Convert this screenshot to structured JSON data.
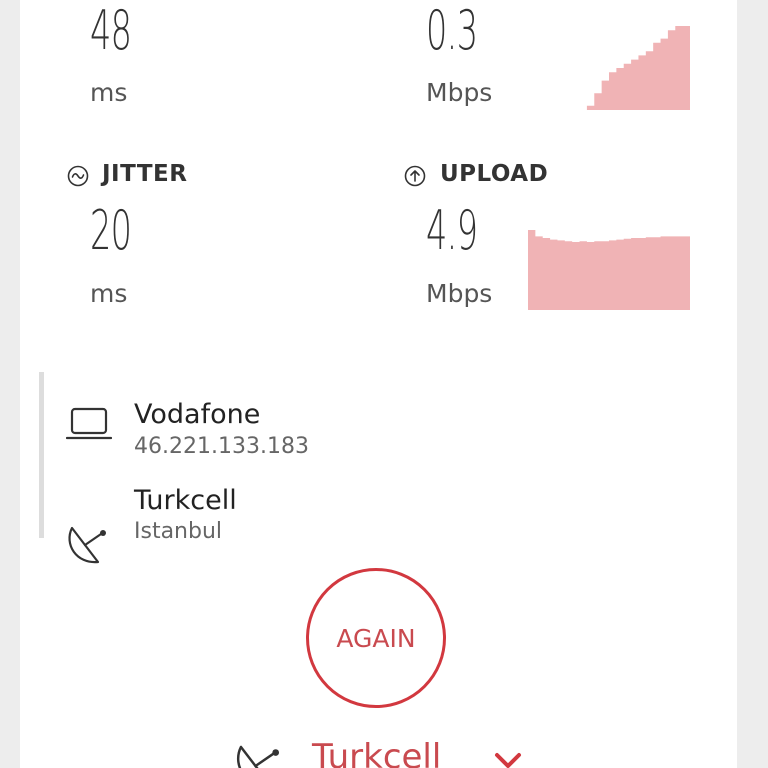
{
  "metrics": {
    "ping": {
      "value": "48",
      "unit": "ms"
    },
    "download": {
      "value": "0.3",
      "unit": "Mbps",
      "spark": [
        0,
        0,
        0,
        0,
        0,
        0,
        0,
        0,
        0.05,
        0.2,
        0.35,
        0.45,
        0.5,
        0.55,
        0.6,
        0.65,
        0.7,
        0.8,
        0.85,
        0.95,
        1.0,
        1.0
      ]
    },
    "jitter": {
      "label": "JITTER",
      "value": "20",
      "unit": "ms"
    },
    "upload": {
      "label": "UPLOAD",
      "value": "4.9",
      "unit": "Mbps",
      "spark": [
        1.0,
        0.92,
        0.9,
        0.88,
        0.87,
        0.86,
        0.85,
        0.86,
        0.85,
        0.86,
        0.86,
        0.87,
        0.88,
        0.89,
        0.9,
        0.9,
        0.91,
        0.91,
        0.92,
        0.92,
        0.92,
        0.92
      ]
    }
  },
  "provider": {
    "name": "Vodafone",
    "ip": "46.221.133.183"
  },
  "server": {
    "name": "Turkcell",
    "location": "Istanbul"
  },
  "again_label": "AGAIN",
  "selected_server": "Turkcell",
  "colors": {
    "accent": "#d2383f",
    "spark_fill": "#f0b3b5"
  }
}
